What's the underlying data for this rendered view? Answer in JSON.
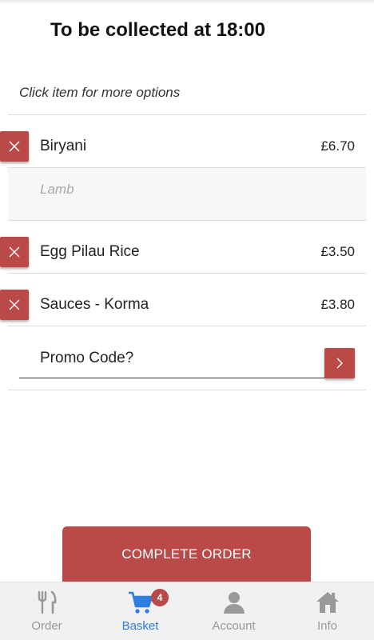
{
  "header": {
    "title": "To be collected at 18:00"
  },
  "hint": "Click item for more options",
  "basket": {
    "items": [
      {
        "name": "Biryani",
        "price": "£6.70",
        "option": "Lamb"
      },
      {
        "name": "Egg Pilau Rice",
        "price": "£3.50"
      },
      {
        "name": "Sauces - Korma",
        "price": "£3.80"
      }
    ]
  },
  "promo": {
    "label": "Promo Code?"
  },
  "actions": {
    "complete_label": "COMPLETE ORDER"
  },
  "tabs": [
    {
      "label": "Order",
      "icon": "cutlery-icon"
    },
    {
      "label": "Basket",
      "icon": "cart-icon",
      "badge": "4",
      "active": true
    },
    {
      "label": "Account",
      "icon": "user-icon"
    },
    {
      "label": "Info",
      "icon": "home-icon"
    }
  ],
  "colors": {
    "accent": "#b94a48",
    "active_tab": "#2f7de1",
    "inactive_tab": "#999999"
  }
}
